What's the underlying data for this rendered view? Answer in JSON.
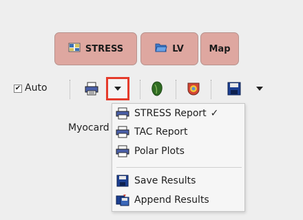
{
  "tabs": [
    {
      "label": "STRESS",
      "icon": "stress-icon"
    },
    {
      "label": "LV",
      "icon": "folder-icon"
    },
    {
      "label": "Map"
    }
  ],
  "toolbar": {
    "auto_label": "Auto",
    "auto_checked": "✔",
    "icons": [
      "print-icon",
      "dropdown-arrow-icon",
      "heart-icon",
      "bullseye-icon",
      "save-icon",
      "dropdown-arrow-icon"
    ]
  },
  "section": {
    "label": "Myocard"
  },
  "menu": {
    "items": [
      {
        "label": "STRESS Report",
        "check": "✓",
        "icon": "print-icon"
      },
      {
        "label": "TAC Report",
        "icon": "print-icon"
      },
      {
        "label": "Polar Plots",
        "icon": "print-icon"
      },
      {
        "label": "Save Results",
        "icon": "save-icon"
      },
      {
        "label": "Append Results",
        "icon": "append-icon"
      }
    ]
  },
  "colors": {
    "tab_bg": "#dea7a0",
    "highlight_border": "#e53b2b",
    "background": "#eeeeee"
  }
}
